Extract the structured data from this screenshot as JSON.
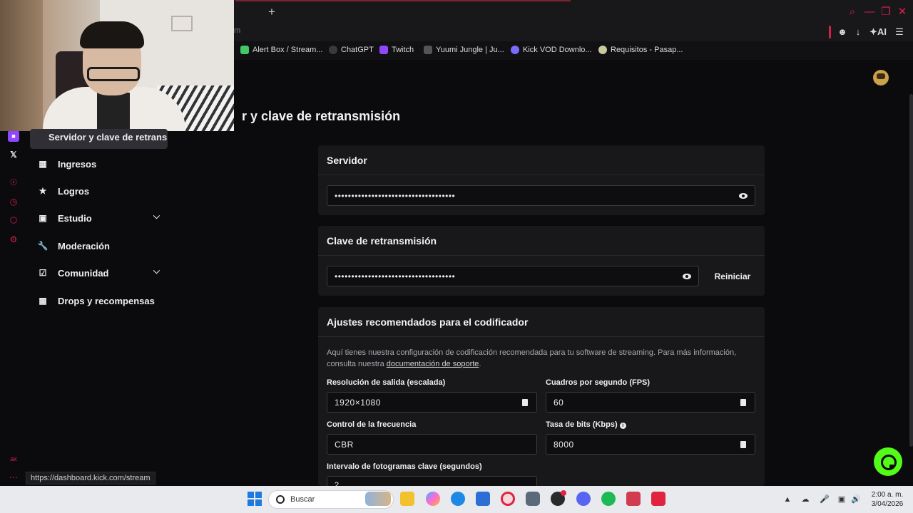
{
  "browser": {
    "new_tab_glyph": "+",
    "url_fragment": "m",
    "window_controls": {
      "search": "⌕",
      "minimize": "—",
      "maximize": "❐",
      "close": "✕"
    },
    "toolbar": {
      "ai_label": "AI"
    },
    "bookmarks": [
      {
        "label": "Alert Box / Stream...",
        "icon": "alert-box-icon",
        "color": "#44c767"
      },
      {
        "label": "ChatGPT",
        "icon": "chatgpt-icon",
        "color": "#dddddd"
      },
      {
        "label": "Twitch",
        "icon": "twitch-icon",
        "color": "#9146ff"
      },
      {
        "label": "Yuumi Jungle | Ju...",
        "icon": "yuumi-icon",
        "color": "#bbbbbb"
      },
      {
        "label": "Kick VOD Downlo...",
        "icon": "kick-vod-icon",
        "color": "#7a6cff"
      },
      {
        "label": "Requisitos - Pasap...",
        "icon": "requisitos-icon",
        "color": "#c9c9a0"
      }
    ],
    "status_url": "https://dashboard.kick.com/stream"
  },
  "page": {
    "title": "r y clave de retransmisión"
  },
  "nav": {
    "tooltip": "Servidor y clave de retransn",
    "items": [
      {
        "label": "Ingresos",
        "icon": "bar-chart-icon"
      },
      {
        "label": "Logros",
        "icon": "trophy-icon"
      },
      {
        "label": "Estudio",
        "icon": "studio-icon",
        "expandable": true
      },
      {
        "label": "Moderación",
        "icon": "wrench-icon"
      },
      {
        "label": "Comunidad",
        "icon": "community-icon",
        "expandable": true
      },
      {
        "label": "Drops y recompensas",
        "icon": "drops-icon"
      }
    ]
  },
  "server": {
    "heading": "Servidor",
    "value": "••••••••••••••••••••••••••••••••••••"
  },
  "stream_key": {
    "heading": "Clave de retransmisión",
    "value": "••••••••••••••••••••••••••••••••••••",
    "reset_label": "Reiniciar"
  },
  "encoder": {
    "heading": "Ajustes recomendados para el codificador",
    "description_prefix": "Aquí tienes nuestra configuración de codificación recomendada para tu software de streaming. Para más información, consulta nuestra ",
    "description_link": "documentación de soporte",
    "description_suffix": ".",
    "resolution_label": "Resolución de salida (escalada)",
    "resolution_value": "1920×1080",
    "fps_label": "Cuadros por segundo (FPS)",
    "fps_value": "60",
    "rate_control_label": "Control de la frecuencia",
    "rate_control_value": "CBR",
    "bitrate_label": "Tasa de bits (Kbps)",
    "bitrate_value": "8000",
    "keyframe_label": "Intervalo de fotogramas clave (segundos)",
    "keyframe_value": "2"
  },
  "taskbar": {
    "search_placeholder": "Buscar",
    "time": "2:00 a. m.",
    "date": "3/04/2026"
  },
  "colors": {
    "kick_green": "#53fc18",
    "opera_red": "#d5214a",
    "card_bg": "#18181b",
    "page_bg": "#0b0b0d"
  }
}
